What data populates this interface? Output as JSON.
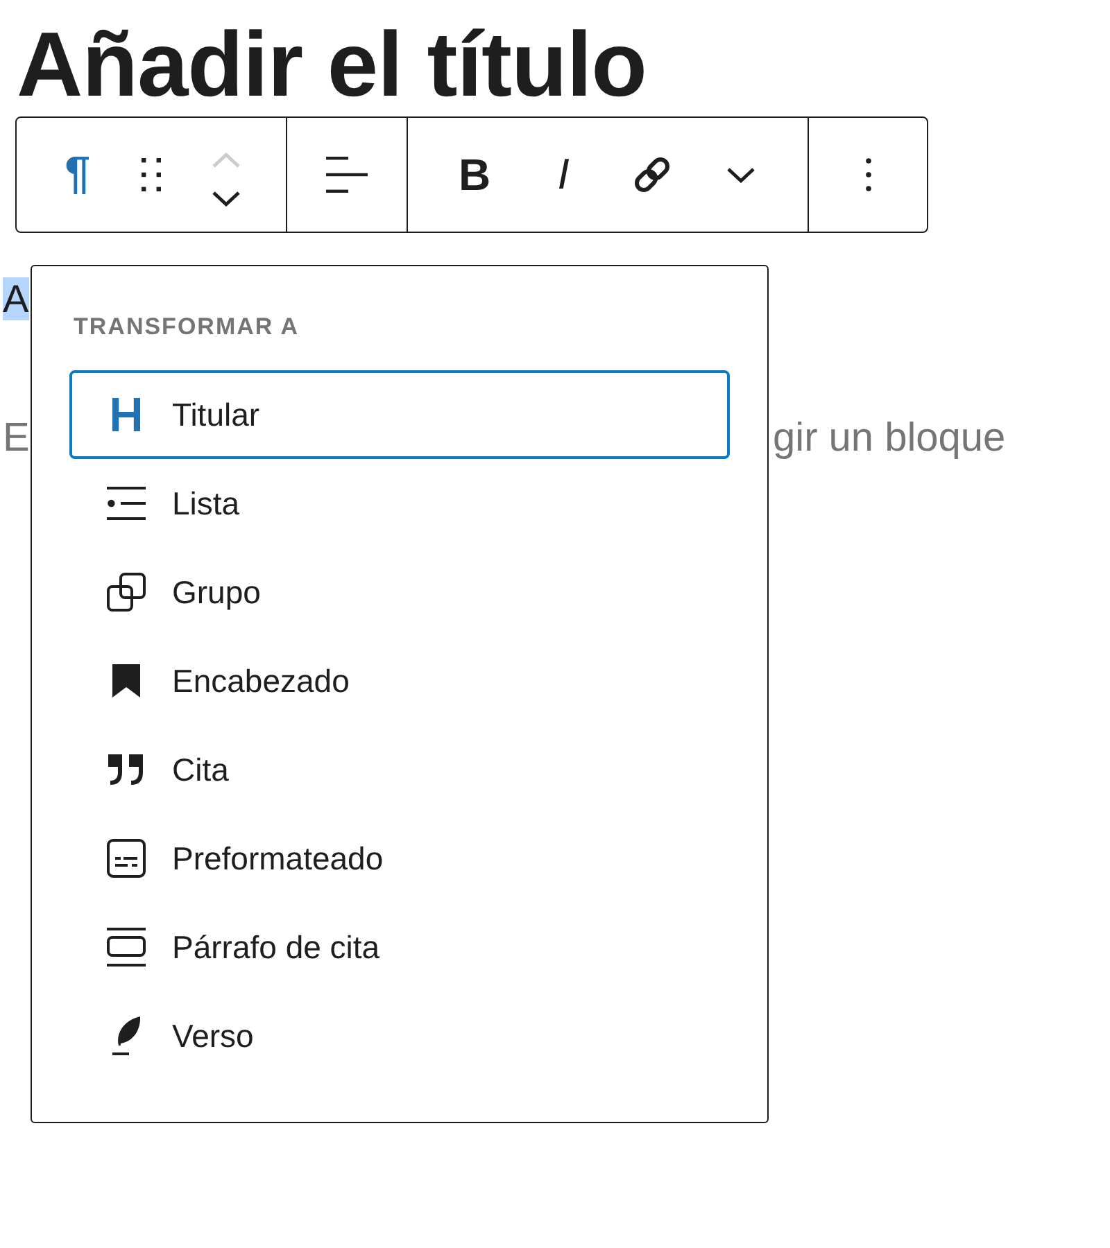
{
  "title": {
    "text": "Añadir el título"
  },
  "toolbar": {
    "groups": [
      {
        "buttons": [
          {
            "kind": "block-type"
          },
          {
            "kind": "drag"
          },
          {
            "kind": "mover",
            "up_disabled": true,
            "down_disabled": false
          }
        ]
      },
      {
        "buttons": [
          {
            "kind": "align"
          }
        ]
      },
      {
        "buttons": [
          {
            "kind": "bold",
            "label": "B"
          },
          {
            "kind": "italic",
            "label": "I"
          },
          {
            "kind": "link"
          },
          {
            "kind": "more-chevron"
          }
        ]
      },
      {
        "buttons": [
          {
            "kind": "options"
          }
        ]
      }
    ]
  },
  "editor": {
    "paragraph": {
      "text": "A",
      "highlighted": true
    },
    "placeholder_parts": [
      "E",
      "gir un bloque"
    ]
  },
  "transform_menu": {
    "heading": "TRANSFORMAR A",
    "items": [
      {
        "kind": "heading",
        "label": "Titular",
        "selected": true
      },
      {
        "kind": "list",
        "label": "Lista",
        "selected": false
      },
      {
        "kind": "group",
        "label": "Grupo",
        "selected": false
      },
      {
        "kind": "bookmark",
        "label": "Encabezado",
        "selected": false
      },
      {
        "kind": "quote",
        "label": "Cita",
        "selected": false
      },
      {
        "kind": "preformatted",
        "label": "Preformateado",
        "selected": false
      },
      {
        "kind": "pullquote",
        "label": "Párrafo de cita",
        "selected": false
      },
      {
        "kind": "verse",
        "label": "Verso",
        "selected": false
      }
    ]
  }
}
